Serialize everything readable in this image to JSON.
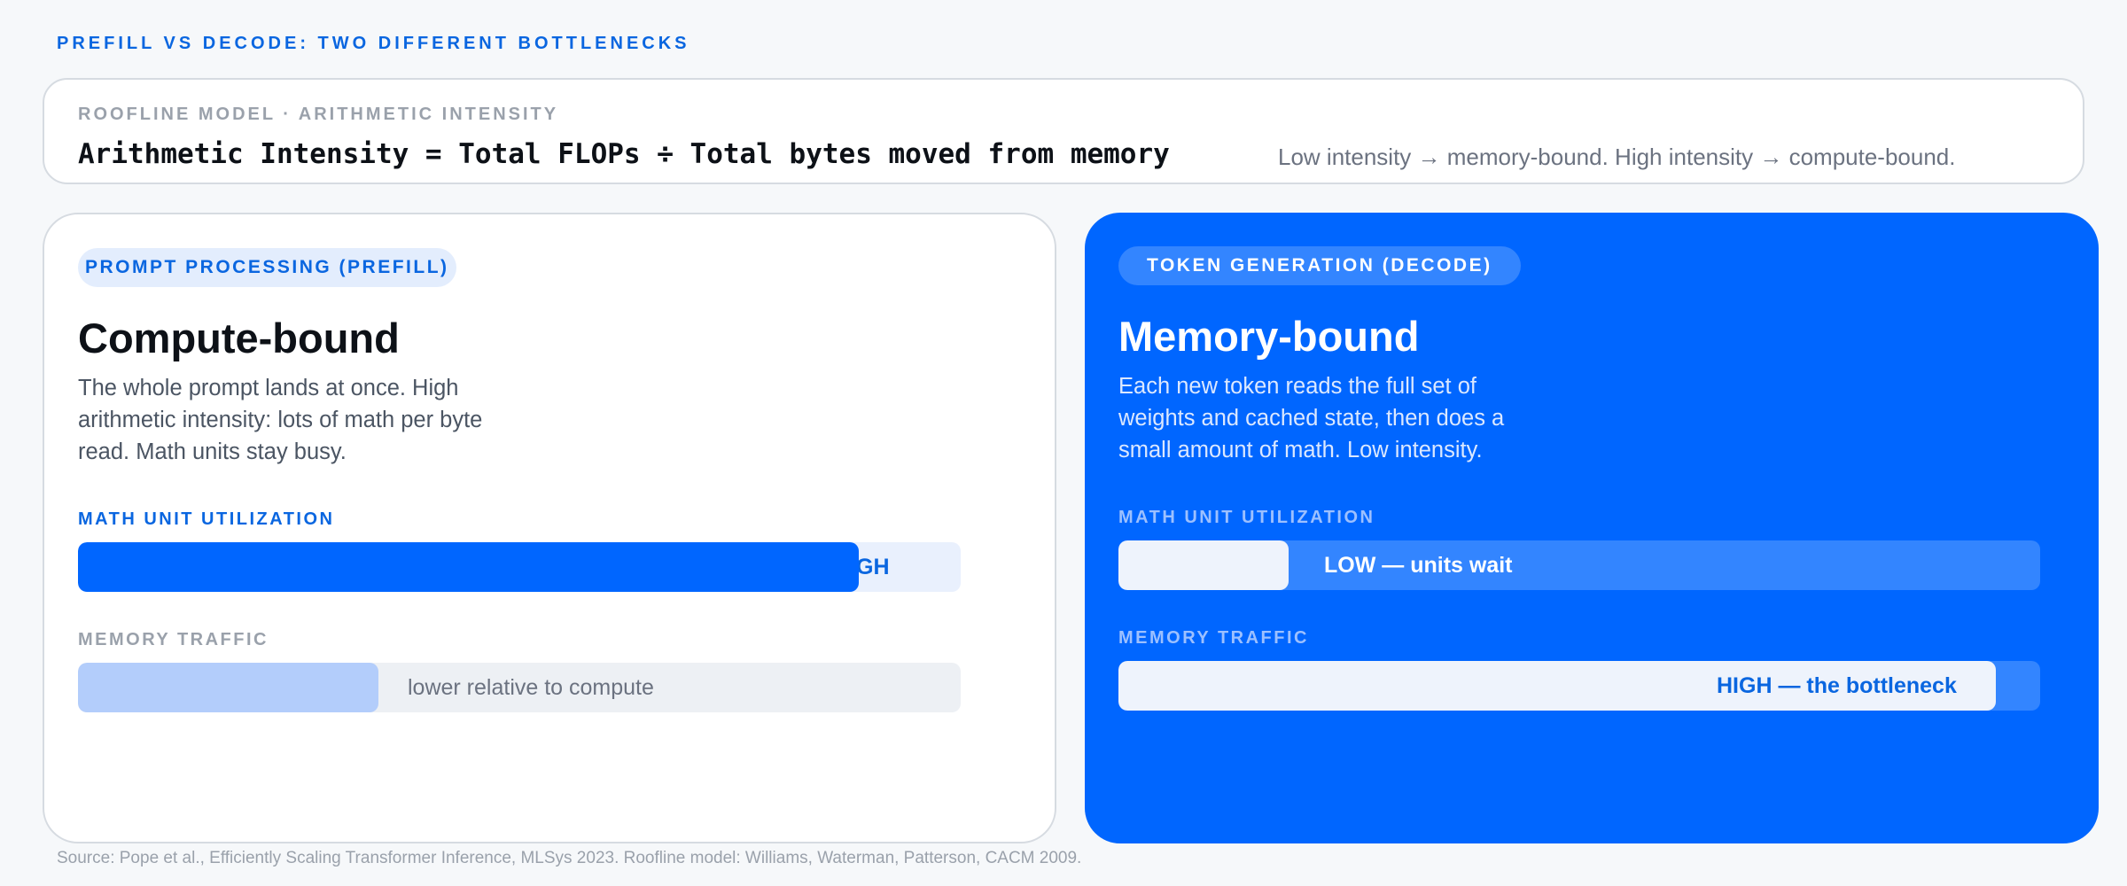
{
  "header": {
    "eyebrow": "PREFILL VS DECODE: TWO DIFFERENT BOTTLENECKS"
  },
  "formula": {
    "kicker": "ROOFLINE MODEL · ARITHMETIC INTENSITY",
    "equation": "Arithmetic Intensity = Total FLOPs ÷ Total bytes moved from memory",
    "note": "Low intensity → memory-bound. High intensity → compute-bound."
  },
  "prefill": {
    "pill": "PROMPT PROCESSING (PREFILL)",
    "title": "Compute-bound",
    "description": "The whole prompt lands at once. High arithmetic intensity: lots of math per byte read. Math units stay busy.",
    "math_label": "MATH UNIT UTILIZATION",
    "math_text": "GH",
    "math_level": 0.885,
    "memory_label": "MEMORY TRAFFIC",
    "memory_text": "lower relative to compute",
    "memory_level": 0.34
  },
  "decode": {
    "pill": "TOKEN GENERATION (DECODE)",
    "title": "Memory-bound",
    "description": "Each new token reads the full set of weights and cached state, then does a small amount of math. Low intensity.",
    "math_label": "MATH UNIT UTILIZATION",
    "math_text": "LOW — units wait",
    "math_level": 0.185,
    "memory_label": "MEMORY TRAFFIC",
    "memory_text": "HIGH — the bottleneck",
    "memory_level": 0.952
  },
  "colors": {
    "accent": "#0066ff",
    "accent_text": "#0a66e0",
    "light_track": "#e9f0fd",
    "gray_track": "#edf0f4",
    "soft_blue": "#b3cdfb",
    "decode_track": "#3385ff",
    "decode_fill": "#eef3fc"
  },
  "footer": {
    "source": "Source: Pope et al., Efficiently Scaling Transformer Inference, MLSys 2023. Roofline model: Williams, Waterman, Patterson, CACM 2009."
  }
}
